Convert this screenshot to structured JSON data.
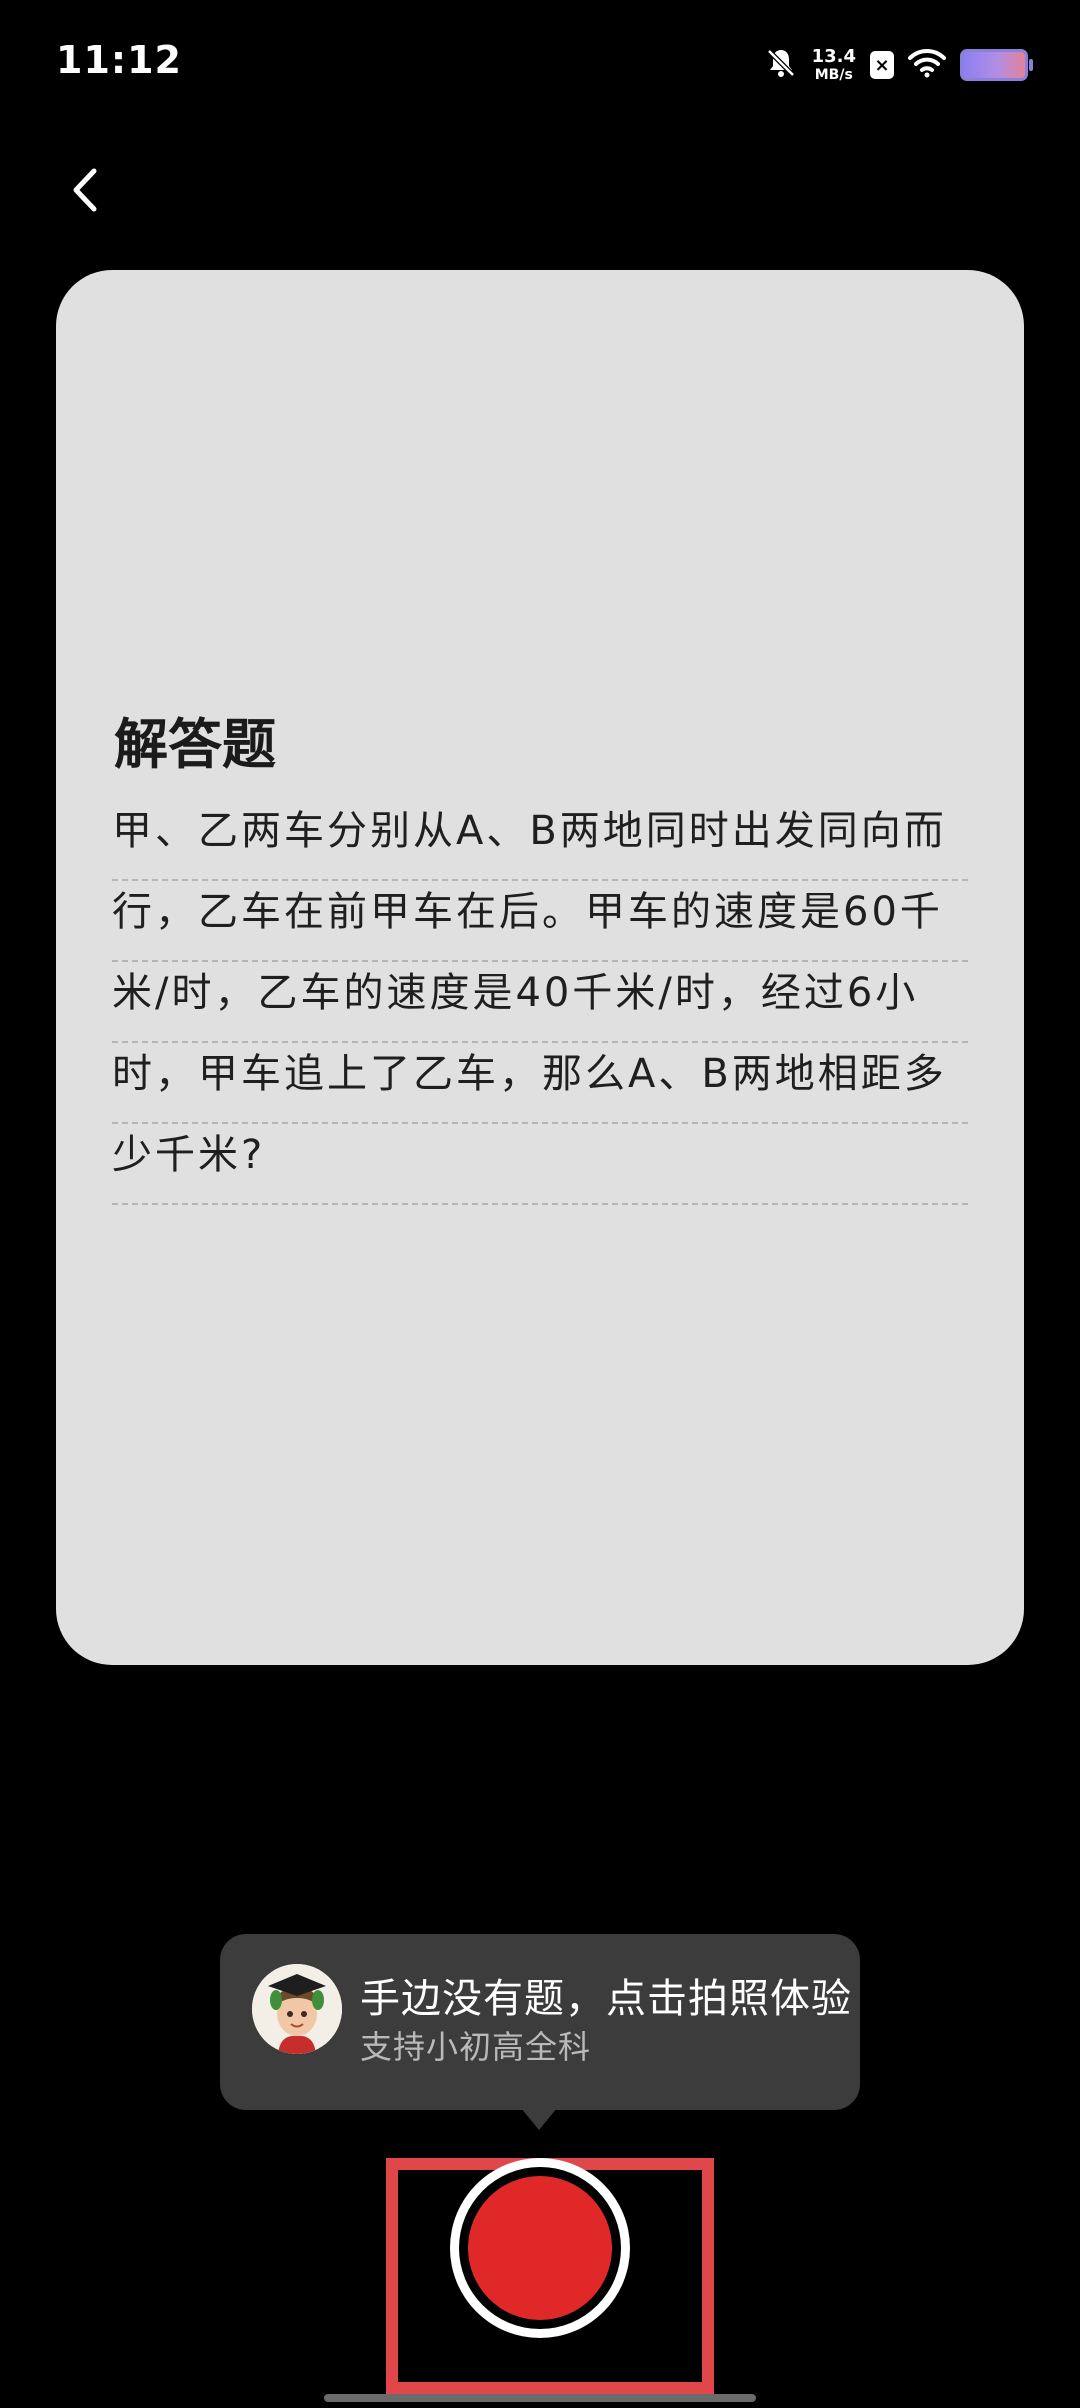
{
  "status_bar": {
    "time": "11:12",
    "net_speed_value": "13.4",
    "net_speed_unit": "MB/s",
    "icons": [
      "mute-bell-icon",
      "close-badge-icon",
      "wifi-icon",
      "battery-icon"
    ]
  },
  "nav": {
    "back_icon": "chevron-left-icon"
  },
  "question": {
    "title": "解答题",
    "lines": [
      "甲、乙两车分别从A、B两地同时出发同向而",
      "行，乙车在前甲车在后。甲车的速度是60千",
      "米/时，乙车的速度是40千米/时，经过6小",
      "时，甲车追上了乙车，那么A、B两地相距多",
      "少千米?"
    ]
  },
  "tip": {
    "main": "手边没有题，点击拍照体验",
    "sub": "支持小初高全科",
    "avatar_icon": "graduate-avatar-icon"
  },
  "colors": {
    "background": "#000000",
    "card": "#e0e0e0",
    "tip_bubble": "#3c3c3c",
    "shutter": "#e02828",
    "highlight_frame": "#e0474a"
  }
}
